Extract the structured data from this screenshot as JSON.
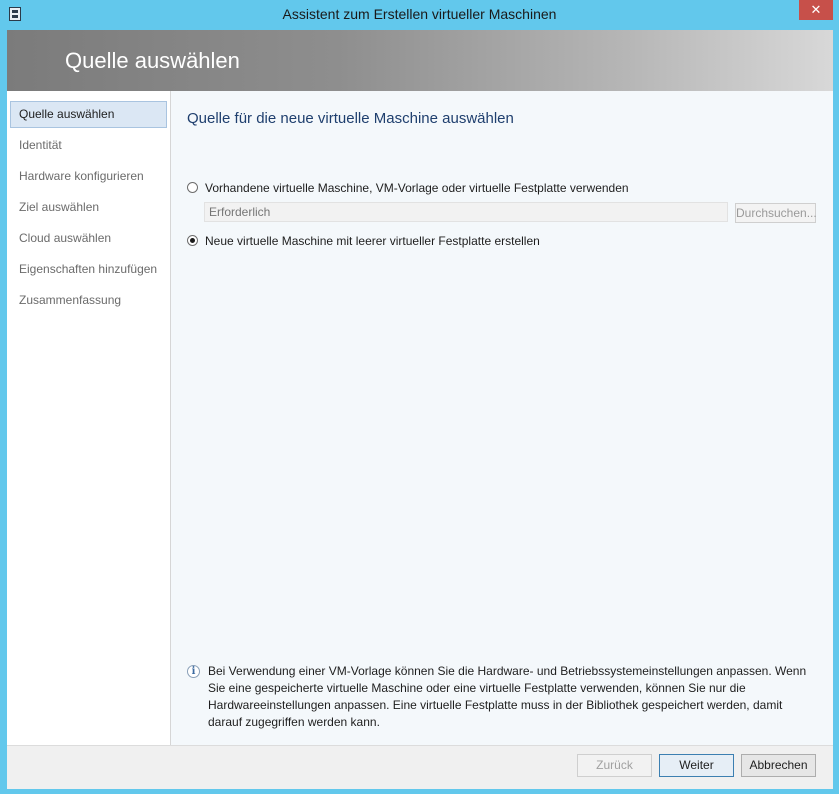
{
  "window": {
    "title": "Assistent zum Erstellen virtueller Maschinen",
    "close_glyph": "✕"
  },
  "header": {
    "title": "Quelle auswählen"
  },
  "sidebar": {
    "items": [
      {
        "label": "Quelle auswählen",
        "active": true
      },
      {
        "label": "Identität"
      },
      {
        "label": "Hardware konfigurieren"
      },
      {
        "label": "Ziel auswählen"
      },
      {
        "label": "Cloud auswählen"
      },
      {
        "label": "Eigenschaften hinzufügen"
      },
      {
        "label": "Zusammenfassung"
      }
    ]
  },
  "main": {
    "heading": "Quelle für die neue virtuelle Maschine auswählen",
    "option_existing": {
      "label": "Vorhandene virtuelle Maschine, VM-Vorlage oder virtuelle Festplatte verwenden",
      "selected": false
    },
    "path_input": {
      "placeholder": "Erforderlich",
      "value": ""
    },
    "browse_label": "Durchsuchen...",
    "option_new": {
      "label": "Neue virtuelle Maschine mit leerer virtueller Festplatte erstellen",
      "selected": true
    },
    "info_icon_glyph": "i",
    "info_text": "Bei Verwendung einer VM-Vorlage können Sie die Hardware- und Betriebssystemeinstellungen anpassen. Wenn Sie eine gespeicherte virtuelle Maschine oder eine virtuelle Festplatte verwenden, können Sie nur die Hardwareeinstellungen anpassen. Eine virtuelle Festplatte muss in der Bibliothek gespeichert werden, damit darauf zugegriffen werden kann."
  },
  "footer": {
    "back_label": "Zurück",
    "next_label": "Weiter",
    "cancel_label": "Abbrechen"
  },
  "colors": {
    "window_frame": "#62c8ec",
    "header_gradient_start": "#7b7b7b",
    "heading_text": "#1f3f6e",
    "nav_active_bg": "#dbe7f4",
    "close_button": "#c7504a"
  }
}
